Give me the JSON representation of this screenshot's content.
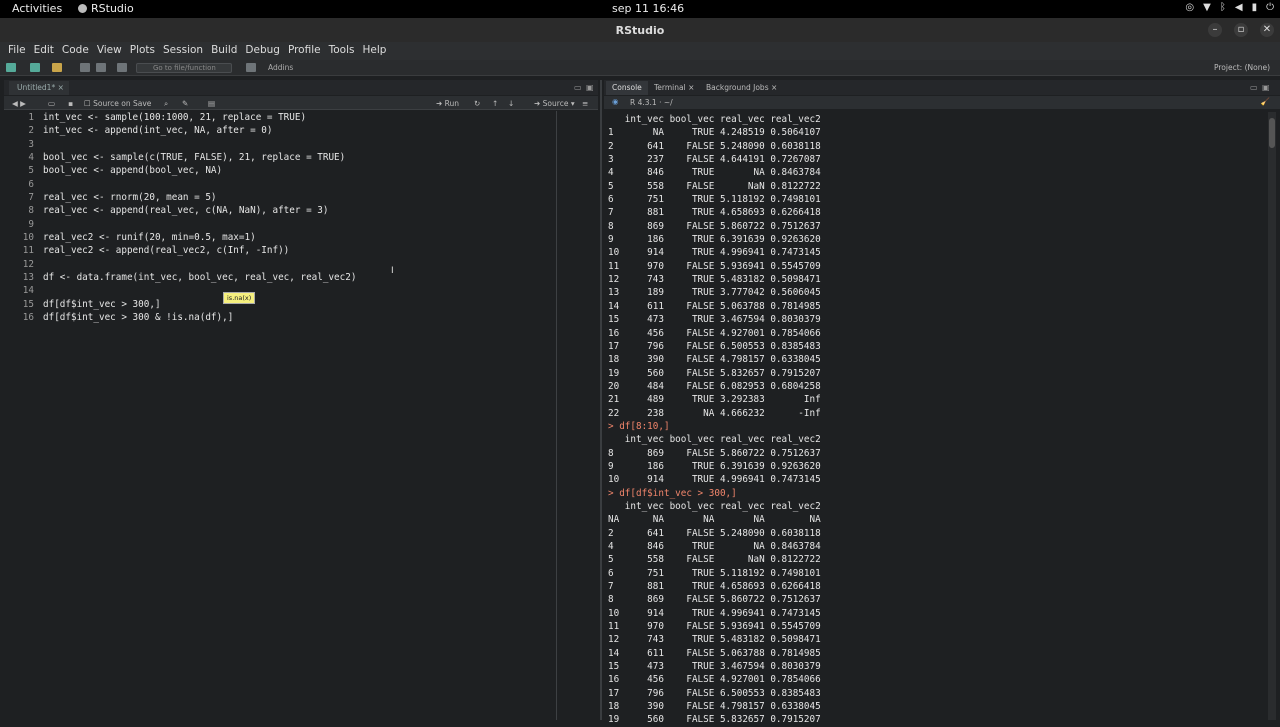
{
  "topbar": {
    "activities": "Activities",
    "app_name": "RStudio",
    "clock": "sep 11  16:46"
  },
  "window": {
    "title": "RStudio"
  },
  "menu": [
    "File",
    "Edit",
    "Code",
    "View",
    "Plots",
    "Session",
    "Build",
    "Debug",
    "Profile",
    "Tools",
    "Help"
  ],
  "toolbar": {
    "goto_placeholder": "Go to file/function",
    "addins": "Addins",
    "project": "Project: (None)"
  },
  "editor": {
    "tab_name": "Untitled1*",
    "source_on_save": "Source on Save",
    "run_label": "Run",
    "source_label": "Source",
    "lines": [
      "int_vec <- sample(100:1000, 21, replace = TRUE)",
      "int_vec <- append(int_vec, NA, after = 0)",
      "",
      "bool_vec <- sample(c(TRUE, FALSE), 21, replace = TRUE)",
      "bool_vec <- append(bool_vec, NA)",
      "",
      "real_vec <- rnorm(20, mean = 5)",
      "real_vec <- append(real_vec, c(NA, NaN), after = 3)",
      "",
      "real_vec2 <- runif(20, min=0.5, max=1)",
      "real_vec2 <- append(real_vec2, c(Inf, -Inf))",
      "",
      "df <- data.frame(int_vec, bool_vec, real_vec, real_vec2)",
      "",
      "df[df$int_vec > 300,]",
      "df[df$int_vec > 300 & !is.na(df),]"
    ],
    "tooltip": "is.na(x)"
  },
  "console": {
    "tabs": [
      "Console",
      "Terminal",
      "Background Jobs"
    ],
    "r_version": "R 4.3.1 · ~/",
    "lines": [
      {
        "t": "   int_vec bool_vec real_vec real_vec2",
        "c": false
      },
      {
        "t": "1       NA     TRUE 4.248519 0.5064107",
        "c": false
      },
      {
        "t": "2      641    FALSE 5.248090 0.6038118",
        "c": false
      },
      {
        "t": "3      237    FALSE 4.644191 0.7267087",
        "c": false
      },
      {
        "t": "4      846     TRUE       NA 0.8463784",
        "c": false
      },
      {
        "t": "5      558    FALSE      NaN 0.8122722",
        "c": false
      },
      {
        "t": "6      751     TRUE 5.118192 0.7498101",
        "c": false
      },
      {
        "t": "7      881     TRUE 4.658693 0.6266418",
        "c": false
      },
      {
        "t": "8      869    FALSE 5.860722 0.7512637",
        "c": false
      },
      {
        "t": "9      186     TRUE 6.391639 0.9263620",
        "c": false
      },
      {
        "t": "10     914     TRUE 4.996941 0.7473145",
        "c": false
      },
      {
        "t": "11     970    FALSE 5.936941 0.5545709",
        "c": false
      },
      {
        "t": "12     743     TRUE 5.483182 0.5098471",
        "c": false
      },
      {
        "t": "13     189     TRUE 3.777042 0.5606045",
        "c": false
      },
      {
        "t": "14     611    FALSE 5.063788 0.7814985",
        "c": false
      },
      {
        "t": "15     473     TRUE 3.467594 0.8030379",
        "c": false
      },
      {
        "t": "16     456    FALSE 4.927001 0.7854066",
        "c": false
      },
      {
        "t": "17     796    FALSE 6.500553 0.8385483",
        "c": false
      },
      {
        "t": "18     390    FALSE 4.798157 0.6338045",
        "c": false
      },
      {
        "t": "19     560    FALSE 5.832657 0.7915207",
        "c": false
      },
      {
        "t": "20     484    FALSE 6.082953 0.6804258",
        "c": false
      },
      {
        "t": "21     489     TRUE 3.292383       Inf",
        "c": false
      },
      {
        "t": "22     238       NA 4.666232      -Inf",
        "c": false
      },
      {
        "t": "> df[8:10,]",
        "c": true
      },
      {
        "t": "   int_vec bool_vec real_vec real_vec2",
        "c": false
      },
      {
        "t": "8      869    FALSE 5.860722 0.7512637",
        "c": false
      },
      {
        "t": "9      186     TRUE 6.391639 0.9263620",
        "c": false
      },
      {
        "t": "10     914     TRUE 4.996941 0.7473145",
        "c": false
      },
      {
        "t": "> df[df$int_vec > 300,]",
        "c": true
      },
      {
        "t": "   int_vec bool_vec real_vec real_vec2",
        "c": false
      },
      {
        "t": "NA      NA       NA       NA        NA",
        "c": false
      },
      {
        "t": "2      641    FALSE 5.248090 0.6038118",
        "c": false
      },
      {
        "t": "4      846     TRUE       NA 0.8463784",
        "c": false
      },
      {
        "t": "5      558    FALSE      NaN 0.8122722",
        "c": false
      },
      {
        "t": "6      751     TRUE 5.118192 0.7498101",
        "c": false
      },
      {
        "t": "7      881     TRUE 4.658693 0.6266418",
        "c": false
      },
      {
        "t": "8      869    FALSE 5.860722 0.7512637",
        "c": false
      },
      {
        "t": "10     914     TRUE 4.996941 0.7473145",
        "c": false
      },
      {
        "t": "11     970    FALSE 5.936941 0.5545709",
        "c": false
      },
      {
        "t": "12     743     TRUE 5.483182 0.5098471",
        "c": false
      },
      {
        "t": "14     611    FALSE 5.063788 0.7814985",
        "c": false
      },
      {
        "t": "15     473     TRUE 3.467594 0.8030379",
        "c": false
      },
      {
        "t": "16     456    FALSE 4.927001 0.7854066",
        "c": false
      },
      {
        "t": "17     796    FALSE 6.500553 0.8385483",
        "c": false
      },
      {
        "t": "18     390    FALSE 4.798157 0.6338045",
        "c": false
      },
      {
        "t": "19     560    FALSE 5.832657 0.7915207",
        "c": false
      }
    ]
  }
}
